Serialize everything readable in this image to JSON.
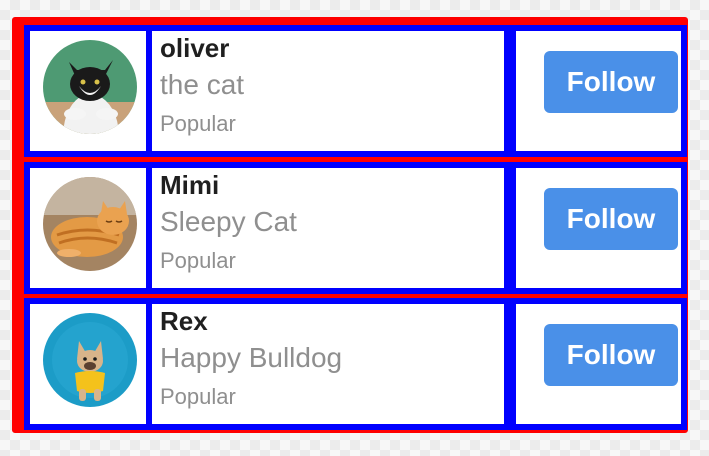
{
  "colors": {
    "outer_border": "#ff0000",
    "card_border": "#0000ff",
    "button_bg": "#4a90e8",
    "button_text": "#ffffff",
    "name_text": "#1f1f1f",
    "secondary_text": "#8f8f8f"
  },
  "users": [
    {
      "name": "oliver",
      "bio": "the cat",
      "tag": "Popular",
      "button_label": "Follow",
      "avatar_icon": "tuxedo-cat-avatar"
    },
    {
      "name": "Mimi",
      "bio": "Sleepy Cat",
      "tag": "Popular",
      "button_label": "Follow",
      "avatar_icon": "orange-cat-avatar"
    },
    {
      "name": "Rex",
      "bio": "Happy Bulldog",
      "tag": "Popular",
      "button_label": "Follow",
      "avatar_icon": "bulldog-avatar"
    }
  ]
}
